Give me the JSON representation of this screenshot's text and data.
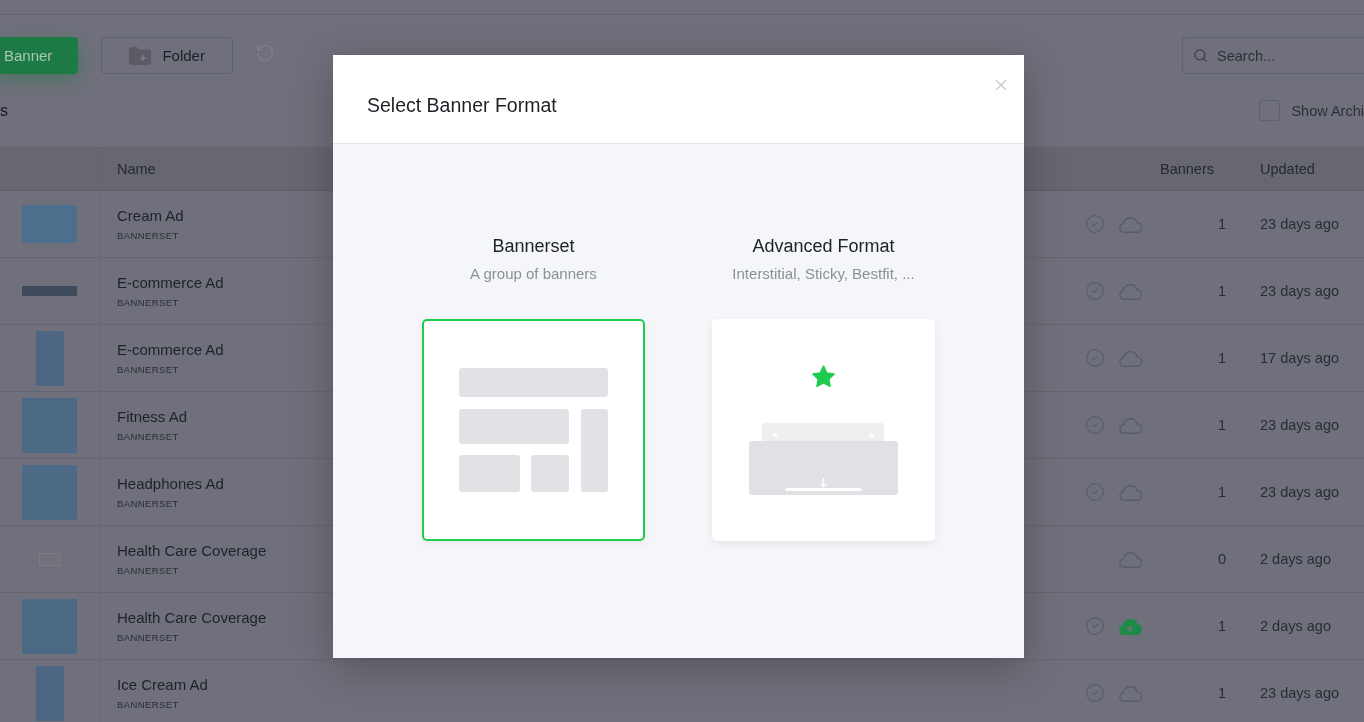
{
  "toolbar": {
    "new_button": "Banner",
    "folder_button": "Folder",
    "search": {
      "placeholder": "Search..."
    }
  },
  "filter_bar": {
    "heading": "s",
    "show_archived": {
      "label": "Show Archi",
      "checked": false
    }
  },
  "table": {
    "columns": [
      "Name",
      "Banners",
      "Updated"
    ],
    "rows": [
      {
        "thumbnail": {
          "kind": "landscape"
        },
        "name": "Cream Ad",
        "type": "BANNERSET",
        "approved": true,
        "published": false,
        "banners": "1",
        "updated": "23 days ago"
      },
      {
        "thumbnail": {
          "kind": "strip"
        },
        "name": "E-commerce Ad",
        "type": "BANNERSET",
        "approved": true,
        "published": false,
        "banners": "1",
        "updated": "23 days ago"
      },
      {
        "thumbnail": {
          "kind": "portrait"
        },
        "name": "E-commerce Ad",
        "type": "BANNERSET",
        "approved": true,
        "published": false,
        "banners": "1",
        "updated": "17 days ago"
      },
      {
        "thumbnail": {
          "kind": "square"
        },
        "name": "Fitness Ad",
        "type": "BANNERSET",
        "approved": true,
        "published": false,
        "banners": "1",
        "updated": "23 days ago"
      },
      {
        "thumbnail": {
          "kind": "square"
        },
        "name": "Headphones Ad",
        "type": "BANNERSET",
        "approved": true,
        "published": false,
        "banners": "1",
        "updated": "23 days ago"
      },
      {
        "thumbnail": {
          "kind": "icon"
        },
        "name": "Health Care Coverage",
        "type": "BANNERSET",
        "approved": false,
        "published": false,
        "banners": "0",
        "updated": "2 days ago"
      },
      {
        "thumbnail": {
          "kind": "square"
        },
        "name": "Health Care Coverage",
        "type": "BANNERSET",
        "approved": true,
        "published": true,
        "banners": "1",
        "updated": "2 days ago"
      },
      {
        "thumbnail": {
          "kind": "portrait"
        },
        "name": "Ice Cream Ad",
        "type": "BANNERSET",
        "approved": true,
        "published": false,
        "banners": "1",
        "updated": "23 days ago"
      }
    ]
  },
  "modal": {
    "title": "Select Banner Format",
    "options": [
      {
        "kind": "bannerset",
        "title": "Bannerset",
        "subtitle": "A group of banners",
        "selected": true
      },
      {
        "kind": "advanced",
        "title": "Advanced Format",
        "subtitle": "Interstitial, Sticky, Bestfit, ...",
        "selected": false
      }
    ]
  }
}
